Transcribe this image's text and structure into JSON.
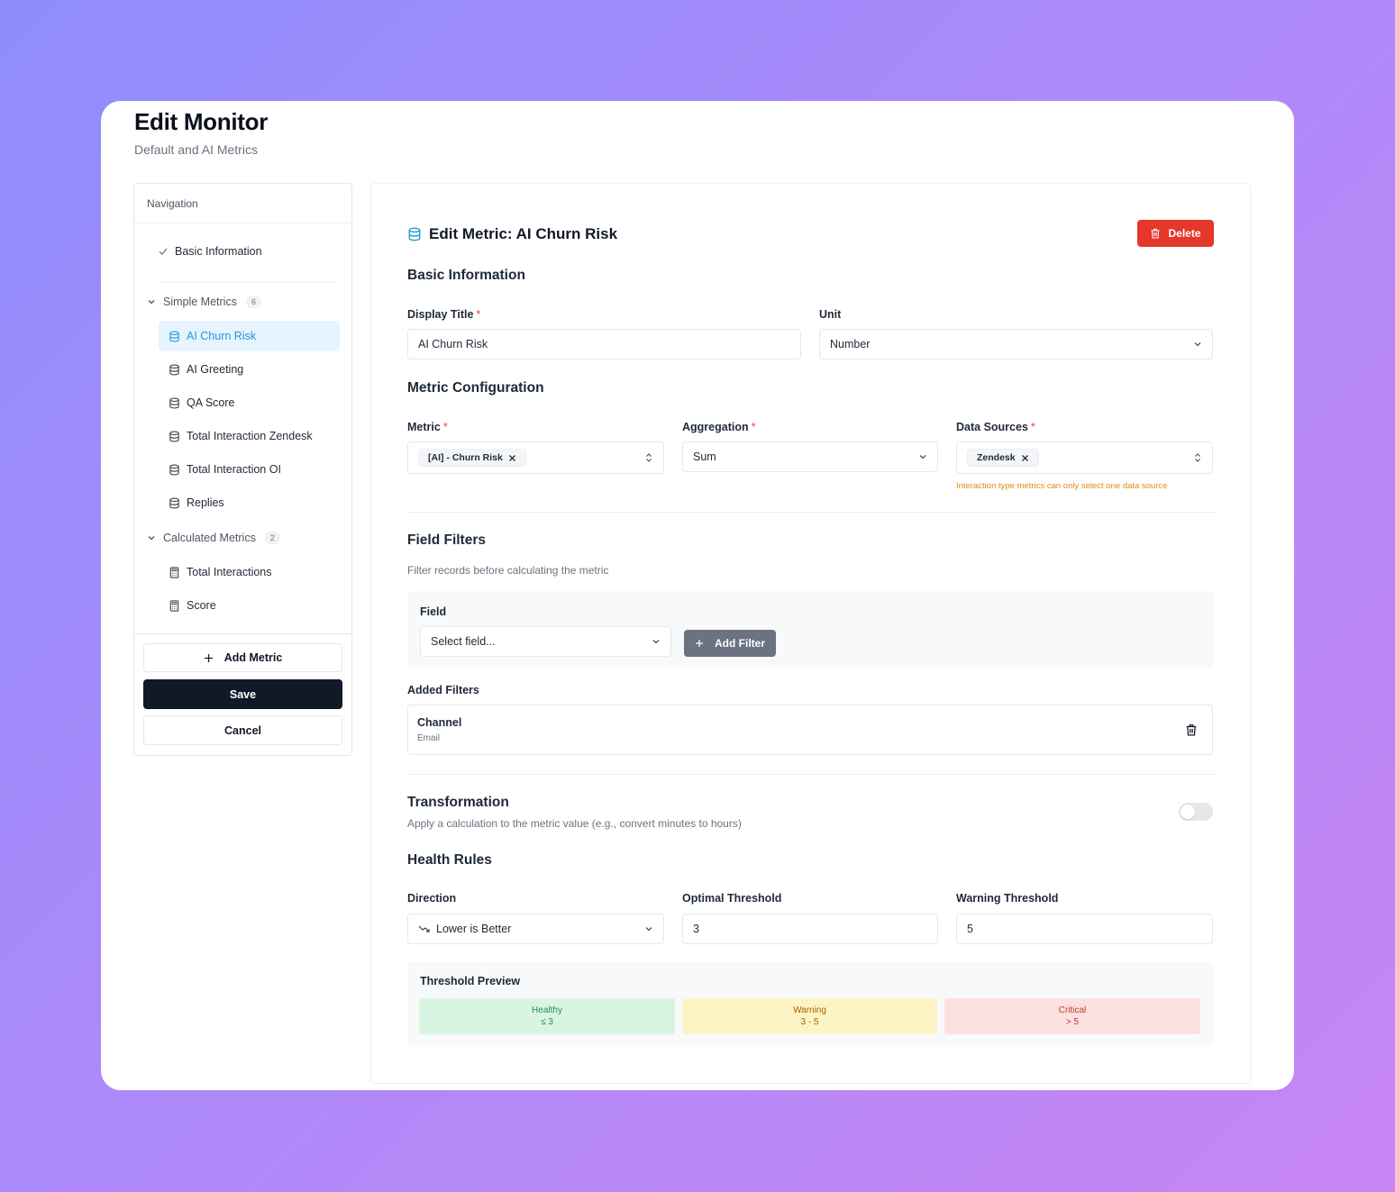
{
  "header": {
    "title": "Edit Monitor",
    "subtitle": "Default and AI Metrics"
  },
  "sidebar": {
    "title": "Navigation",
    "basic_info": "Basic Information",
    "simple_group": {
      "label": "Simple Metrics",
      "count": "6"
    },
    "simple_items": [
      "AI Churn Risk",
      "AI Greeting",
      "QA Score",
      "Total Interaction Zendesk",
      "Total Interaction OI",
      "Replies"
    ],
    "calculated_group": {
      "label": "Calculated Metrics",
      "count": "2"
    },
    "calculated_items": [
      "Total Interactions",
      "Score"
    ],
    "add_metric": "Add Metric",
    "save": "Save",
    "cancel": "Cancel"
  },
  "main": {
    "title": "Edit Metric: AI Churn Risk",
    "delete": "Delete",
    "basic_section": "Basic Information",
    "display_title": {
      "label": "Display Title",
      "value": "AI Churn Risk"
    },
    "unit": {
      "label": "Unit",
      "value": "Number"
    },
    "config_section": "Metric Configuration",
    "metric": {
      "label": "Metric",
      "chip": "[AI] - Churn Risk"
    },
    "aggregation": {
      "label": "Aggregation",
      "value": "Sum"
    },
    "data_sources": {
      "label": "Data Sources",
      "chip": "Zendesk",
      "hint": "Interaction type metrics can only select one data source"
    },
    "filters_section": "Field Filters",
    "filters_desc": "Filter records before calculating the metric",
    "field": {
      "label": "Field",
      "placeholder": "Select field..."
    },
    "add_filter": "Add Filter",
    "added_filters_label": "Added Filters",
    "added_filters": [
      {
        "name": "Channel",
        "value": "Email"
      }
    ],
    "transformation": {
      "title": "Transformation",
      "desc": "Apply a calculation to the metric value (e.g., convert minutes to hours)",
      "enabled": false
    },
    "health_section": "Health Rules",
    "direction": {
      "label": "Direction",
      "value": "Lower is Better"
    },
    "optimal": {
      "label": "Optimal Threshold",
      "value": "3"
    },
    "warning": {
      "label": "Warning Threshold",
      "value": "5"
    },
    "preview": {
      "label": "Threshold Preview",
      "healthy": {
        "label": "Healthy",
        "range": "≤ 3"
      },
      "warning": {
        "label": "Warning",
        "range": "3 - 5"
      },
      "critical": {
        "label": "Critical",
        "range": "> 5"
      }
    }
  },
  "colors": {
    "accent": "#1e9ad6",
    "danger": "#e5372b",
    "primary_button": "#111827"
  }
}
